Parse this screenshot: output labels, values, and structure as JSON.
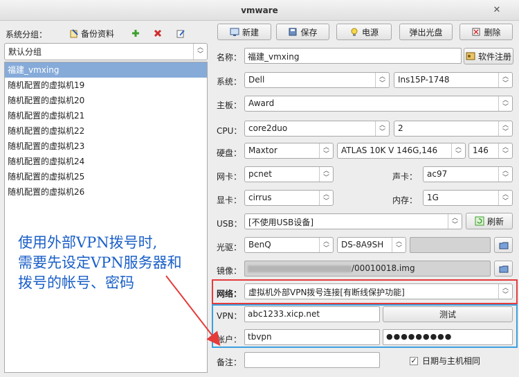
{
  "window": {
    "title": "vmware",
    "close_glyph": "✕"
  },
  "sidebar": {
    "group_label": "系统分组：",
    "backup_label": "备份资料",
    "group_value": "默认分组",
    "items": [
      "福建_vmxing",
      "随机配置的虚拟机19",
      "随机配置的虚拟机20",
      "随机配置的虚拟机21",
      "随机配置的虚拟机22",
      "随机配置的虚拟机23",
      "随机配置的虚拟机24",
      "随机配置的虚拟机25",
      "随机配置的虚拟机26"
    ]
  },
  "toolbar": {
    "new_label": "新建",
    "save_label": "保存",
    "power_label": "电源",
    "eject_label": "弹出光盘",
    "delete_label": "删除"
  },
  "form": {
    "name_label": "名称：",
    "name_value": "福建_vmxing",
    "register_label": "软件注册",
    "system_label": "系统：",
    "system_value": "Dell",
    "system_model": "Ins15P-1748",
    "board_label": "主板：",
    "board_value": "Award",
    "cpu_label": "CPU：",
    "cpu_value": "core2duo",
    "cpu_count": "2",
    "disk_label": "硬盘：",
    "disk_value": "Maxtor",
    "disk_model": "ATLAS 10K V 146G,146",
    "disk_size": "146",
    "nic_label": "网卡：",
    "nic_value": "pcnet",
    "sound_label": "声卡：",
    "sound_value": "ac97",
    "gpu_label": "显卡：",
    "gpu_value": "cirrus",
    "mem_label": "内存：",
    "mem_value": "1G",
    "usb_label": "USB：",
    "usb_value": "[不使用USB设备]",
    "refresh_label": "刷新",
    "optical_label": "光驱：",
    "optical_value": "BenQ",
    "optical_model": "DS-8A9SH",
    "image_label": "镜像：",
    "image_value": "/00010018.img",
    "network_label": "网络：",
    "network_value": "虚拟机外部VPN拨号连接[有断线保护功能]",
    "vpn_label": "VPN：",
    "vpn_value": "abc1233.xicp.net",
    "test_label": "测试",
    "account_label": "帐户：",
    "account_value": "tbvpn",
    "password_value": "●●●●●●●●●",
    "note_label": "备注：",
    "note_value": "",
    "sync_date_label": "日期与主机相同",
    "sync_date_checked": true
  },
  "annotation": {
    "line1": "使用外部VPN拨号时,",
    "line2": "需要先设定VPN服务器和",
    "line3": "拨号的帐号、密码"
  },
  "colors": {
    "selection": "#86abd9",
    "highlight_red": "#e53b3b",
    "highlight_blue": "#3aa0e0",
    "annotation": "#1a5fc8"
  }
}
